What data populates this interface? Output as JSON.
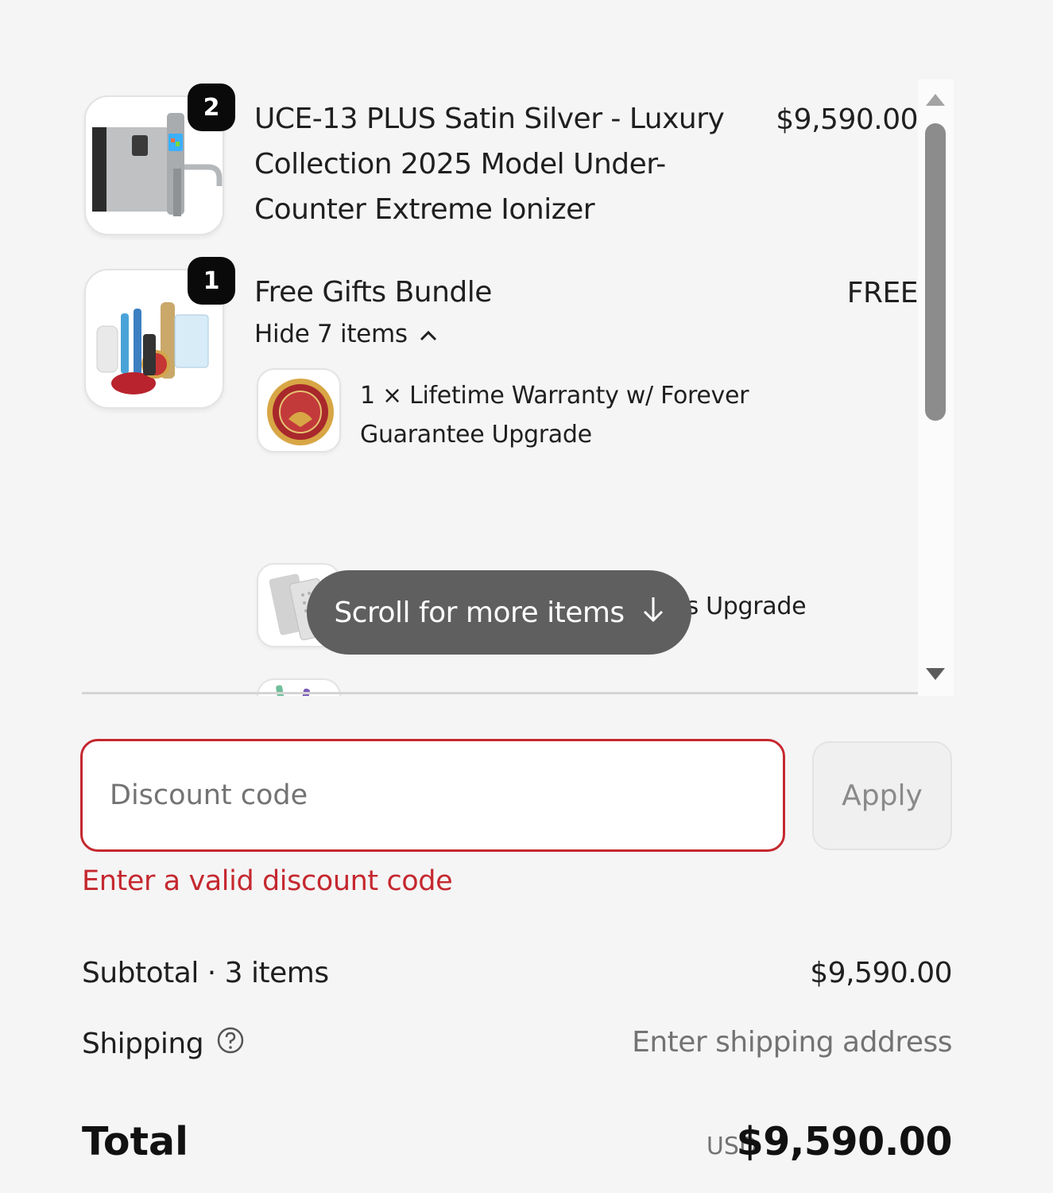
{
  "products": [
    {
      "quantity": "2",
      "title_lines": [
        "UCE-13 PLUS Satin Silver - Luxury",
        "Collection 2025 Model Under-",
        "Counter Extreme Ionizer"
      ],
      "price": "$9,590.00",
      "thumb_icon": "ionizer-product-image"
    },
    {
      "quantity": "1",
      "title": "Free Gifts Bundle",
      "price": "FREE",
      "toggle_label": "Hide 7 items",
      "thumb_icon": "gift-bundle-image",
      "sub_items": [
        {
          "label_lines": [
            "1 × Lifetime Warranty w/ Forever",
            "Guarantee Upgrade"
          ],
          "icon": "warranty-seal-image"
        },
        {
          "label_lines": [
            "1 × Solid/Mesh Hybrid Plates Upgrade"
          ],
          "icon": "hybrid-plates-image"
        },
        {
          "label_lines": [
            ""
          ],
          "icon": "cleaning-brushes-image"
        }
      ]
    }
  ],
  "scroll_hint": "Scroll for more items",
  "discount": {
    "placeholder": "Discount code",
    "apply_label": "Apply",
    "error": "Enter a valid discount code"
  },
  "summary": {
    "subtotal_label": "Subtotal · 3 items",
    "subtotal_value": "$9,590.00",
    "shipping_label": "Shipping",
    "shipping_value": "Enter shipping address",
    "total_label": "Total",
    "total_currency": "USD",
    "total_value": "$9,590.00"
  },
  "colors": {
    "error": "#c5282f",
    "badge": "#0a0a0a",
    "pill": "#5f5f5f"
  }
}
